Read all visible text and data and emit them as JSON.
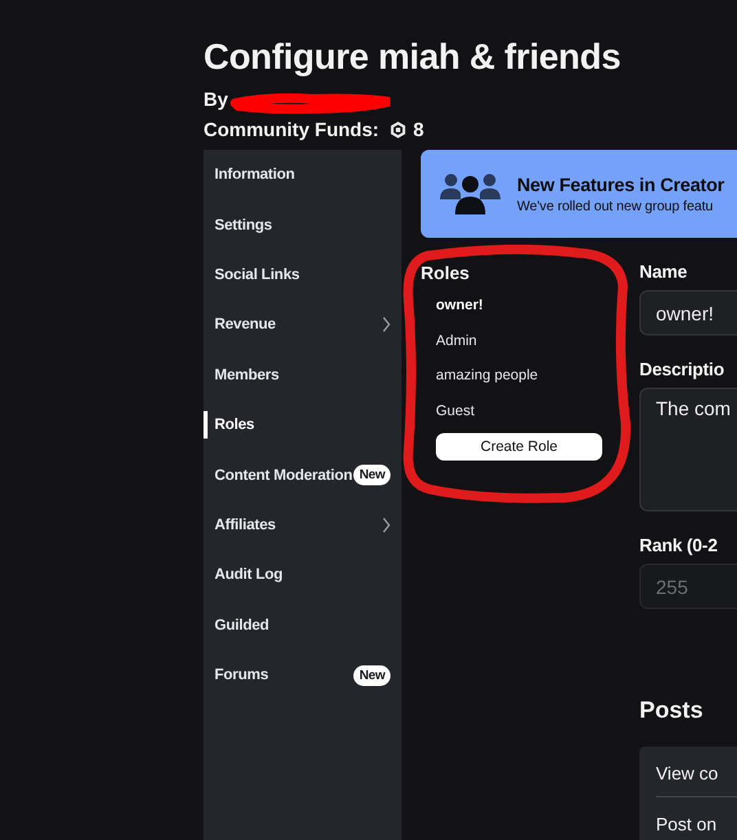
{
  "title": "Configure miah & friends",
  "owner_label": "By",
  "funds": {
    "label": "Community Funds:",
    "amount": "8"
  },
  "sidebar": {
    "items": [
      {
        "label": "Information",
        "selected": false,
        "expandable": false
      },
      {
        "label": "Settings",
        "selected": false,
        "expandable": false
      },
      {
        "label": "Social Links",
        "selected": false,
        "expandable": false
      },
      {
        "label": "Revenue",
        "selected": false,
        "expandable": true
      },
      {
        "label": "Members",
        "selected": false,
        "expandable": false
      },
      {
        "label": "Roles",
        "selected": true,
        "expandable": false
      },
      {
        "label": "Content Moderation",
        "selected": false,
        "expandable": false,
        "badge": "New"
      },
      {
        "label": "Affiliates",
        "selected": false,
        "expandable": true
      },
      {
        "label": "Audit Log",
        "selected": false,
        "expandable": false
      },
      {
        "label": "Guilded",
        "selected": false,
        "expandable": false
      },
      {
        "label": "Forums",
        "selected": false,
        "expandable": false,
        "badge": "New"
      }
    ]
  },
  "banner": {
    "title": "New Features in Creator",
    "text": "We've rolled out new group featu"
  },
  "roles": {
    "title": "Roles",
    "items": [
      {
        "label": "owner!",
        "selected": true
      },
      {
        "label": "Admin",
        "selected": false
      },
      {
        "label": "amazing people",
        "selected": false
      },
      {
        "label": "Guest",
        "selected": false
      }
    ],
    "create_button": "Create Role"
  },
  "form": {
    "name_label": "Name",
    "name_value": "owner!",
    "description_label": "Descriptio",
    "description_value": "The com",
    "rank_label": "Rank (0-2",
    "rank_placeholder": "255"
  },
  "posts": {
    "title": "Posts",
    "rows": [
      "View co",
      "Post on"
    ]
  }
}
